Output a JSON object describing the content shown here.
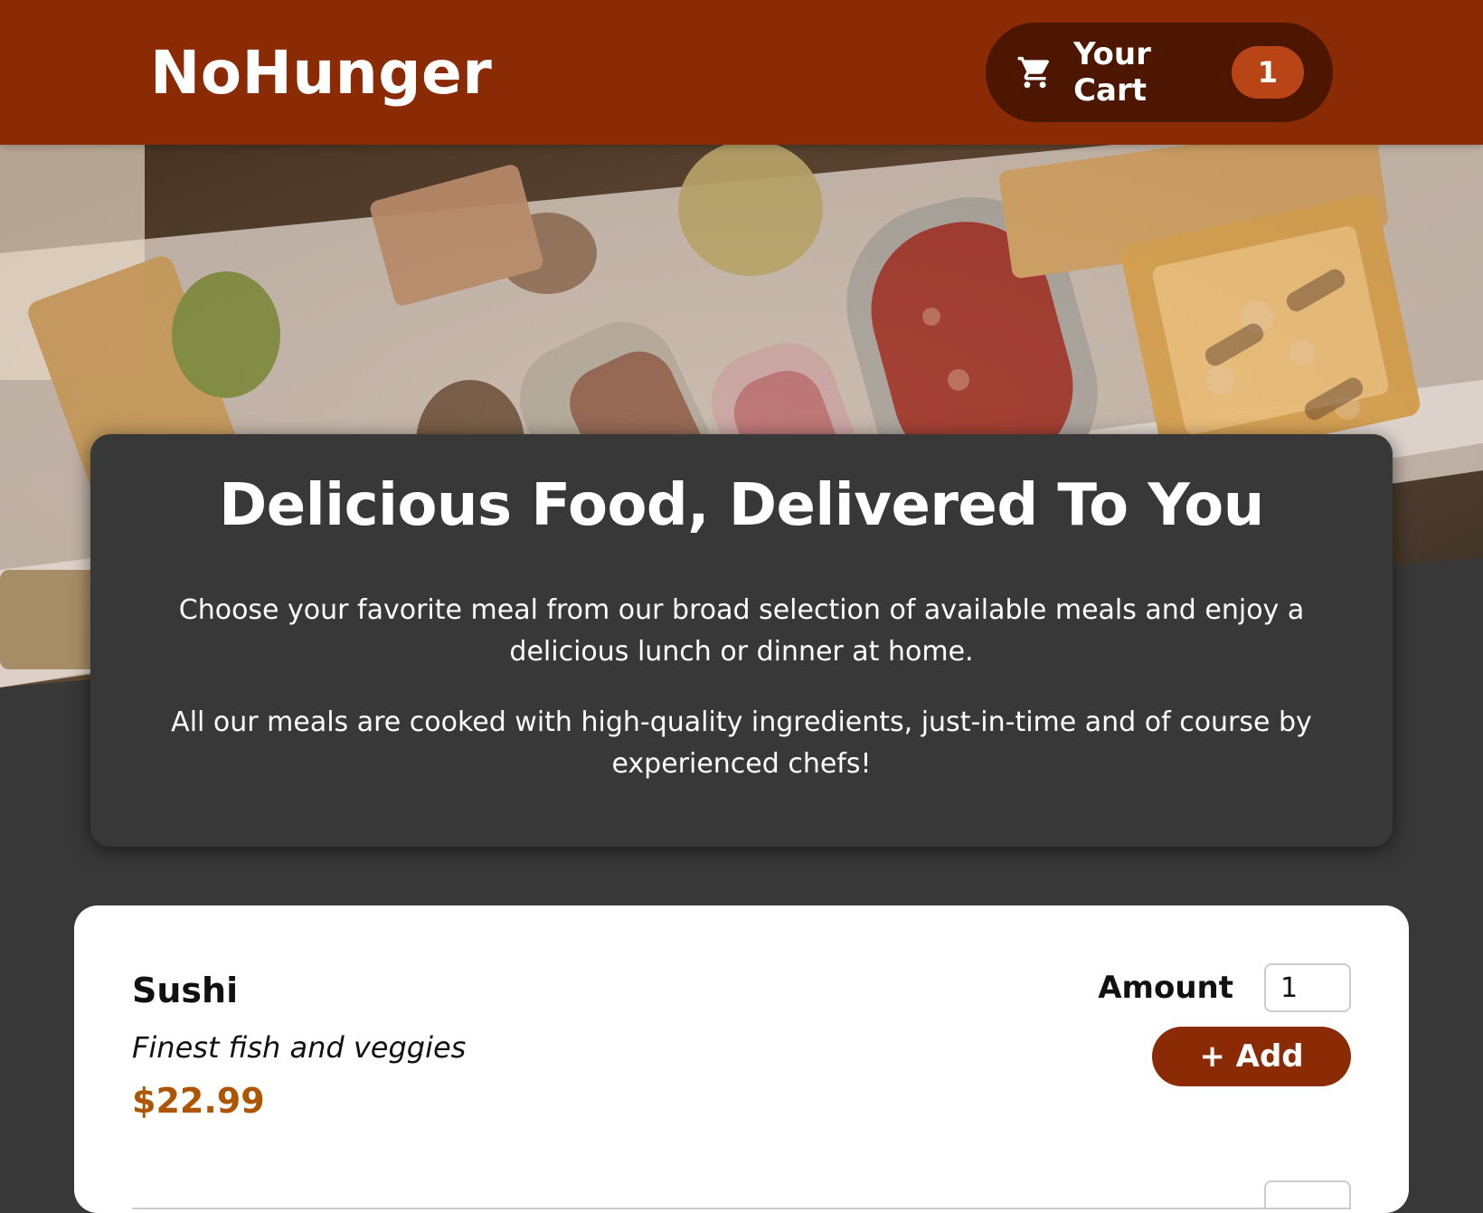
{
  "header": {
    "brand": "NoHunger",
    "cart_label": "Your Cart",
    "cart_count": "1",
    "cart_icon": "shopping-cart-icon"
  },
  "hero": {
    "image": "buffet-table-photo"
  },
  "summary": {
    "title": "Delicious Food, Delivered To You",
    "paragraph1": "Choose your favorite meal from our broad selection of available meals and enjoy a delicious lunch or dinner at home.",
    "paragraph2": "All our meals are cooked with high-quality ingredients, just-in-time and of course by experienced chefs!"
  },
  "meals": [
    {
      "name": "Sushi",
      "description": "Finest fish and veggies",
      "price": "$22.99",
      "amount_label": "Amount",
      "amount_value": "1",
      "add_label": "+ Add"
    }
  ],
  "colors": {
    "header": "#8a2b06",
    "cart_button": "#4d1601",
    "badge": "#b94517",
    "price": "#ad5502",
    "background": "#383838"
  }
}
